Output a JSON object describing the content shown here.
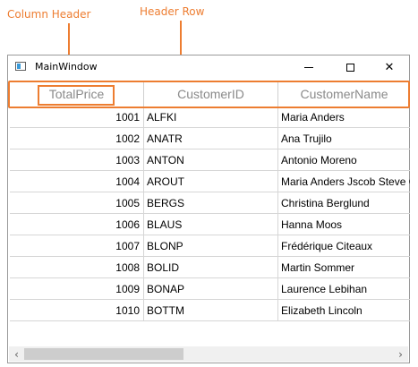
{
  "annotations": {
    "column_header_label": "Column Header",
    "header_row_label": "Header Row",
    "accent_color": "#ED7D31"
  },
  "window": {
    "title": "MainWindow",
    "icon": "app-window-icon",
    "buttons": {
      "minimize": "minimize-icon",
      "maximize": "maximize-icon",
      "close_glyph": "✕"
    }
  },
  "grid": {
    "columns": [
      "TotalPrice",
      "CustomerID",
      "CustomerName"
    ],
    "rows": [
      {
        "total_price": "1001",
        "customer_id": "ALFKI",
        "customer_name": "Maria Anders"
      },
      {
        "total_price": "1002",
        "customer_id": "ANATR",
        "customer_name": "Ana Trujilo"
      },
      {
        "total_price": "1003",
        "customer_id": "ANTON",
        "customer_name": "Antonio Moreno"
      },
      {
        "total_price": "1004",
        "customer_id": "AROUT",
        "customer_name": "Maria Anders Jscob Steve C"
      },
      {
        "total_price": "1005",
        "customer_id": "BERGS",
        "customer_name": "Christina Berglund"
      },
      {
        "total_price": "1006",
        "customer_id": "BLAUS",
        "customer_name": "Hanna Moos"
      },
      {
        "total_price": "1007",
        "customer_id": "BLONP",
        "customer_name": "Frédérique Citeaux"
      },
      {
        "total_price": "1008",
        "customer_id": "BOLID",
        "customer_name": "Martin Sommer"
      },
      {
        "total_price": "1009",
        "customer_id": "BONAP",
        "customer_name": "Laurence Lebihan"
      },
      {
        "total_price": "1010",
        "customer_id": "BOTTM",
        "customer_name": "Elizabeth Lincoln"
      }
    ]
  },
  "scrollbar": {
    "left_arrow": "‹",
    "right_arrow": "›"
  }
}
